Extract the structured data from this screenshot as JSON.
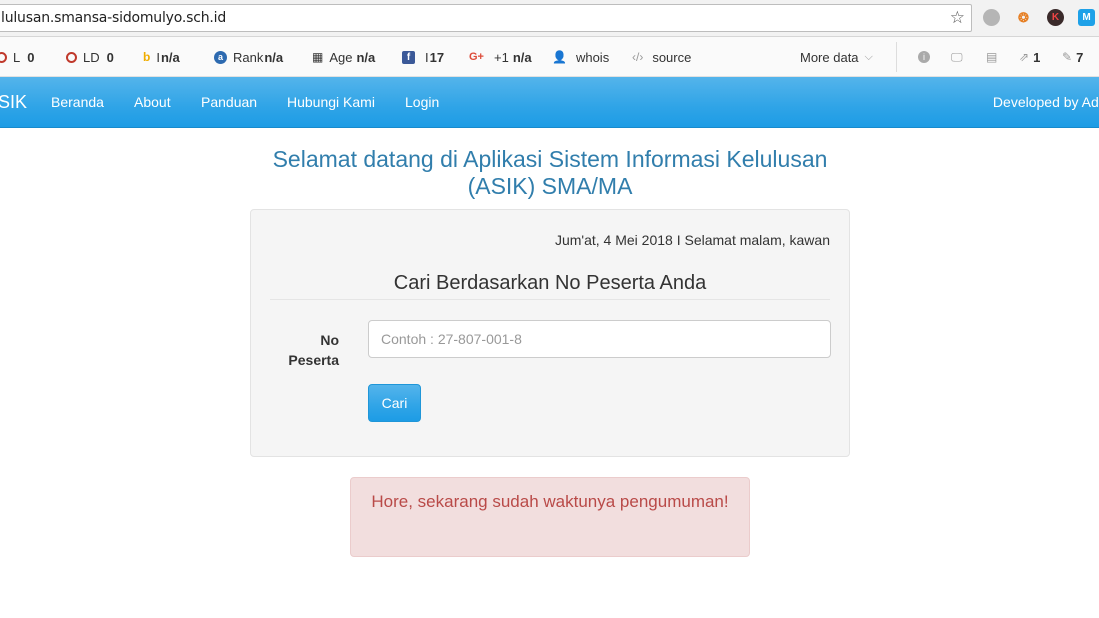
{
  "browser": {
    "url": "lulusan.smansa-sidomulyo.sch.id"
  },
  "seo_toolbar": {
    "items": [
      {
        "label": "L",
        "value": "0"
      },
      {
        "label": "LD",
        "value": "0"
      },
      {
        "label": "I",
        "value": "n/a"
      },
      {
        "label": "Rank",
        "value": "n/a"
      },
      {
        "label": "Age",
        "value": "n/a"
      },
      {
        "label": "I",
        "value": "17"
      },
      {
        "label": "+1",
        "value": "n/a"
      },
      {
        "label": "whois",
        "value": ""
      },
      {
        "label": "source",
        "value": ""
      }
    ],
    "more_data": "More data",
    "right_counts": [
      "1",
      "7"
    ]
  },
  "navbar": {
    "brand": "SIK",
    "links": [
      "Beranda",
      "About",
      "Panduan",
      "Hubungi Kami",
      "Login"
    ],
    "right_text": "Developed by Adil"
  },
  "main": {
    "title": "Selamat datang di Aplikasi Sistem Informasi Kelulusan (ASIK) SMA/MA",
    "date_greeting": "Jum'at, 4 Mei 2018 I Selamat malam, kawan",
    "form_legend": "Cari Berdasarkan No Peserta Anda",
    "field_label": "No Peserta",
    "field_placeholder": "Contoh : 27-807-001-8",
    "search_button": "Cari",
    "alert_text": "Hore, sekarang sudah waktunya pengumuman!"
  },
  "colors": {
    "accent": "#2fa4e7",
    "title": "#317eac",
    "alert_bg": "#f2dede",
    "alert_text": "#b94a48"
  }
}
